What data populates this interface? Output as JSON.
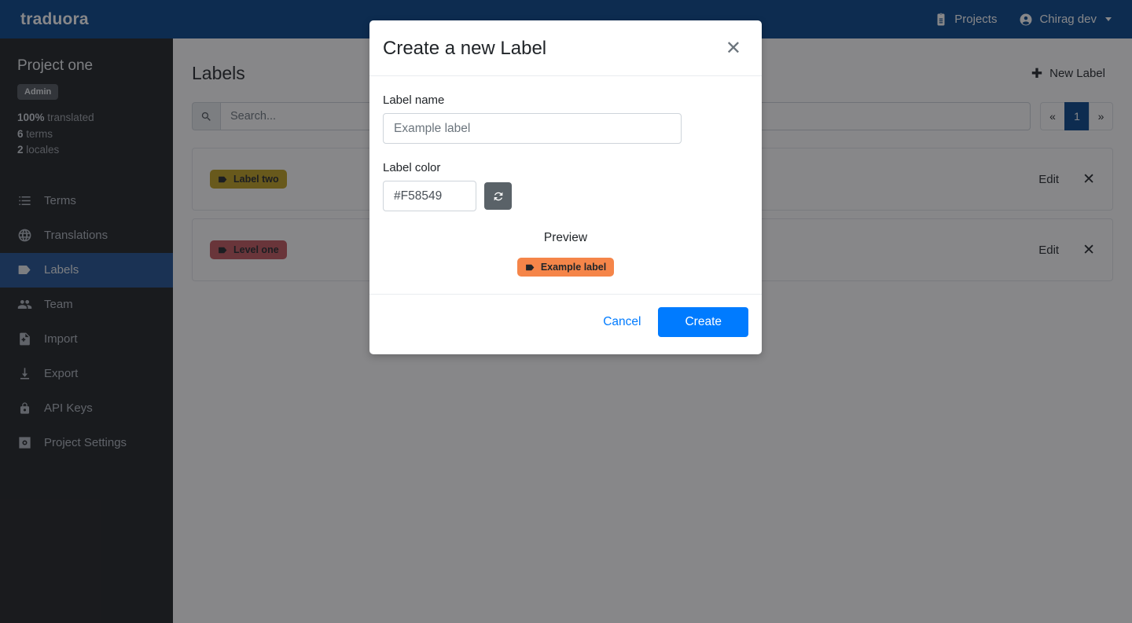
{
  "navbar": {
    "brand": "traduora",
    "projects_label": "Projects",
    "projects_icon": "clipboard-icon",
    "user_label": "Chirag dev",
    "user_icon": "account-circle-icon"
  },
  "sidebar": {
    "project_name": "Project one",
    "role_badge": "Admin",
    "stats": [
      {
        "value": "100%",
        "label": "translated"
      },
      {
        "value": "6",
        "label": "terms"
      },
      {
        "value": "2",
        "label": "locales"
      }
    ],
    "items": [
      {
        "label": "Terms",
        "icon": "list-icon",
        "active": false
      },
      {
        "label": "Translations",
        "icon": "globe-icon",
        "active": false
      },
      {
        "label": "Labels",
        "icon": "tag-icon",
        "active": true
      },
      {
        "label": "Team",
        "icon": "people-icon",
        "active": false
      },
      {
        "label": "Import",
        "icon": "file-import-icon",
        "active": false
      },
      {
        "label": "Export",
        "icon": "download-icon",
        "active": false
      },
      {
        "label": "API Keys",
        "icon": "lock-icon",
        "active": false
      },
      {
        "label": "Project Settings",
        "icon": "settings-gear-icon",
        "active": false
      }
    ]
  },
  "main": {
    "page_title": "Labels",
    "new_label_button": "New Label",
    "new_label_icon": "plus-icon",
    "search": {
      "placeholder": "Search...",
      "value": "",
      "icon": "search-icon"
    },
    "pagination": {
      "prev": "«",
      "current": "1",
      "next": "»"
    },
    "rows": [
      {
        "label": "Label two",
        "color": "#BF9F1C",
        "edit": "Edit",
        "delete_icon": "close-icon",
        "icon": "tag-icon"
      },
      {
        "label": "Level one",
        "color": "#C0555B",
        "edit": "Edit",
        "delete_icon": "close-icon",
        "icon": "tag-icon"
      }
    ]
  },
  "modal": {
    "title": "Create a new Label",
    "close_icon": "close-icon",
    "name_field": {
      "label": "Label name",
      "value": "Example label",
      "placeholder": "Example label"
    },
    "color_field": {
      "label": "Label color",
      "value": "#F58549",
      "placeholder": "#F58549",
      "refresh_icon": "refresh-icon"
    },
    "preview": {
      "title": "Preview",
      "chip_text": "Example label",
      "chip_color": "#F58549",
      "chip_icon": "tag-icon"
    },
    "cancel_button": "Cancel",
    "create_button": "Create"
  }
}
